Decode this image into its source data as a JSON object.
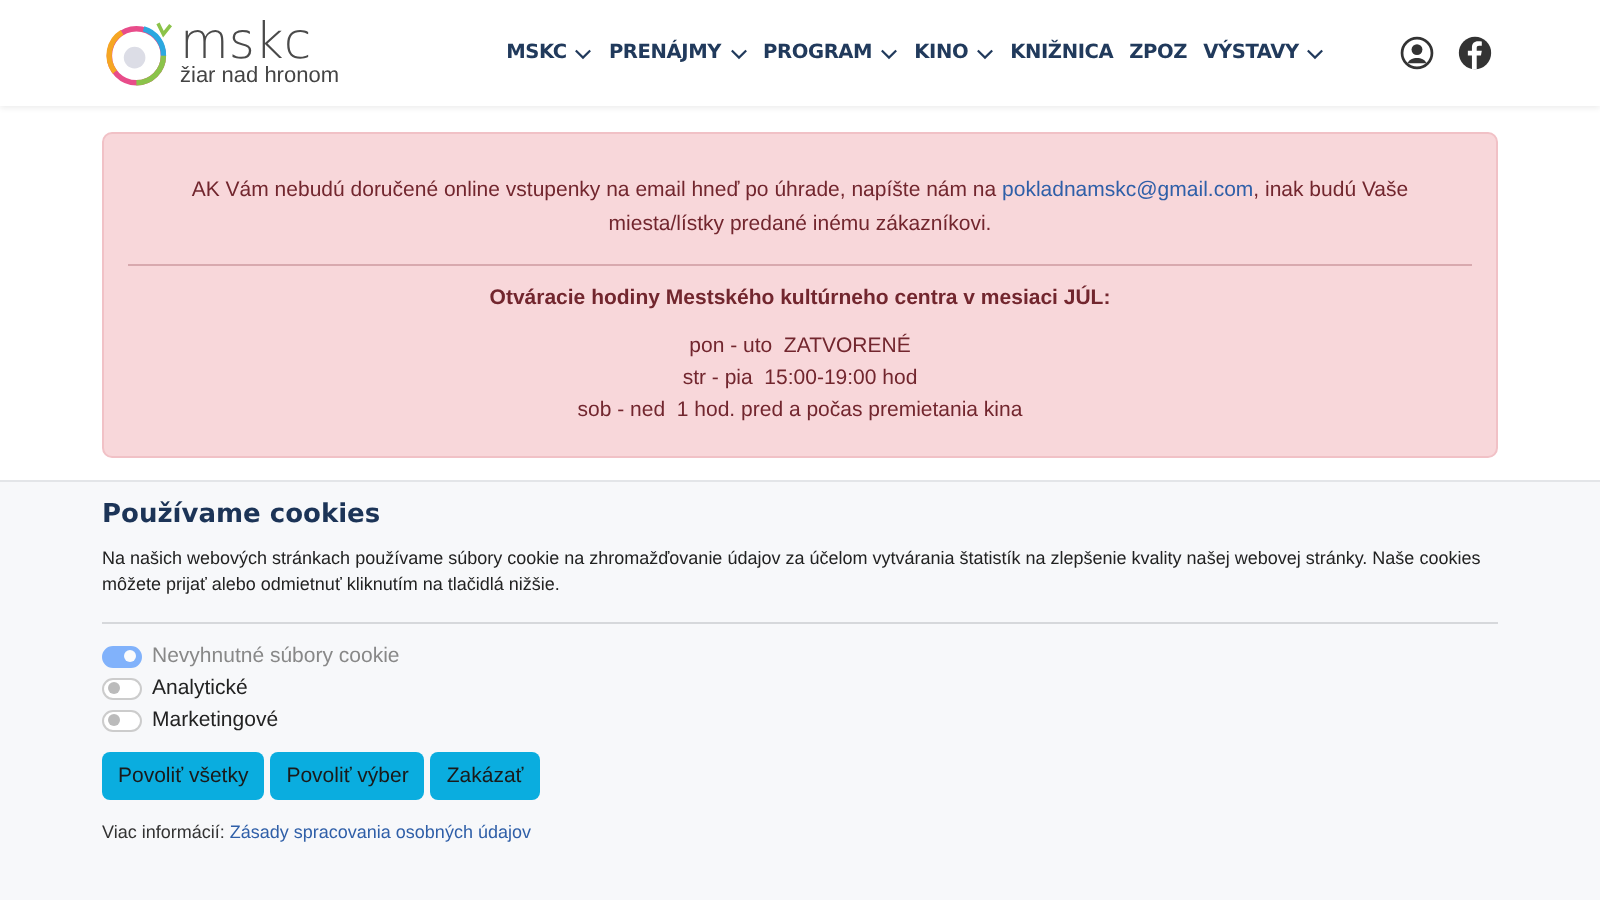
{
  "logo": {
    "name": "mskc",
    "tagline": "žiar nad hronom"
  },
  "nav": [
    {
      "label": "MSKC",
      "dropdown": true
    },
    {
      "label": "PRENÁJMY",
      "dropdown": true
    },
    {
      "label": "PROGRAM",
      "dropdown": true
    },
    {
      "label": "KINO",
      "dropdown": true
    },
    {
      "label": "KNIŽNICA",
      "dropdown": false
    },
    {
      "label": "ZPOZ",
      "dropdown": false
    },
    {
      "label": "VÝSTAVY",
      "dropdown": true
    }
  ],
  "alert": {
    "text_before": "AK Vám nebudú doručené online vstupenky na email hneď po úhrade, napíšte nám na ",
    "email": "pokladnamskc@gmail.com",
    "text_after": ", inak budú Vaše miesta/lístky predané inému zákazníkovi.",
    "hours_title": "Otváracie hodiny Mestského kultúrneho centra v mesiaci JÚL:",
    "hours": [
      "pon - uto  ZATVORENÉ",
      "str - pia  15:00-19:00 hod",
      "sob - ned  1 hod. pred a počas premietania kina"
    ]
  },
  "cookies": {
    "title": "Používame cookies",
    "text": "Na našich webových stránkach používame súbory cookie na zhromažďovanie údajov za účelom vytvárania štatistík na zlepšenie kvality našej webovej stránky. Naše cookies môžete prijať alebo odmietnuť kliknutím na tlačidlá nižšie.",
    "options": [
      {
        "label": "Nevyhnutné súbory cookie",
        "checked": true,
        "disabled": true
      },
      {
        "label": "Analytické",
        "checked": false,
        "disabled": false
      },
      {
        "label": "Marketingové",
        "checked": false,
        "disabled": false
      }
    ],
    "buttons": [
      "Povoliť všetky",
      "Povoliť výber",
      "Zakázať"
    ],
    "more_label": "Viac informácií:",
    "more_link": "Zásady spracovania osobných údajov"
  }
}
